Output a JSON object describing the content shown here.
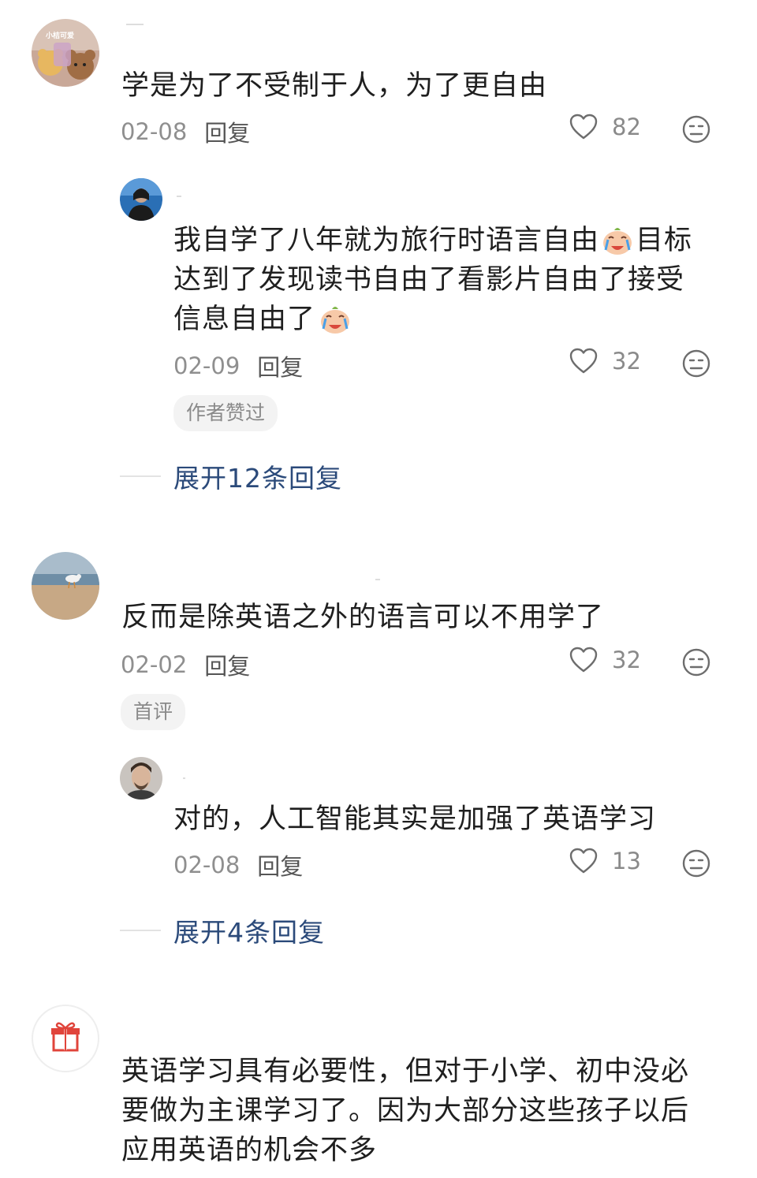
{
  "comments": [
    {
      "text": "学是为了不受制于人，为了更自由",
      "date": "02-08",
      "reply_label": "回复",
      "likes": "82",
      "avatar_tag": "小桔可爱",
      "replies": [
        {
          "text_line1": "我自学了八年就为旅行时语言自由",
          "text_line1_tail": "目标",
          "text_line2": "达到了发现读书自由了看影片自由了接受",
          "text_line3": "信息自由了",
          "date": "02-09",
          "reply_label": "回复",
          "likes": "32",
          "tag": "作者赞过"
        }
      ],
      "expand_label": "展开12条回复"
    },
    {
      "text": "反而是除英语之外的语言可以不用学了",
      "date": "02-02",
      "reply_label": "回复",
      "likes": "32",
      "tag": "首评",
      "replies": [
        {
          "text": "对的，人工智能其实是加强了英语学习",
          "date": "02-08",
          "reply_label": "回复",
          "likes": "13"
        }
      ],
      "expand_label": "展开4条回复"
    },
    {
      "text_line1": "英语学习具有必要性，但对于小学、初中没必",
      "text_line2": "要做为主课学习了。因为大部分这些孩子以后",
      "text_line3": "应用英语的机会不多"
    }
  ],
  "icons": {
    "like": "heart-outline-icon",
    "react": "neutral-face-icon",
    "emoji": "crying-face-emoji",
    "gift": "gift-icon"
  },
  "colors": {
    "link": "#2b4a7a",
    "meta": "#8f8f8f",
    "tag_bg": "#f3f3f3",
    "gift": "#e0443b"
  }
}
